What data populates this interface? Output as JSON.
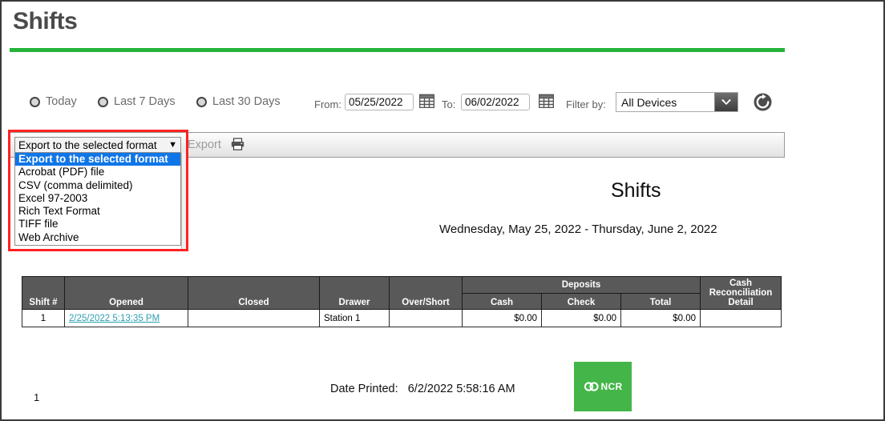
{
  "page": {
    "title": "Shifts",
    "accent_color": "#25b33a"
  },
  "filters": {
    "radios": [
      {
        "label": "Today",
        "selected": false
      },
      {
        "label": "Last 7 Days",
        "selected": false
      },
      {
        "label": "Last 30 Days",
        "selected": false
      }
    ],
    "from_label": "From:",
    "from_value": "05/25/2022",
    "to_label": "To:",
    "to_value": "06/02/2022",
    "filter_by_label": "Filter by:",
    "device_value": "All Devices",
    "refresh_icon": "refresh-icon",
    "calendar_icon": "calendar-icon"
  },
  "toolbar": {
    "export_label": "Export",
    "printer_icon": "printer-icon",
    "dropdown_selected": "Export to the selected format",
    "dropdown_options": [
      "Export to the selected format",
      "Acrobat (PDF) file",
      "CSV (comma delimited)",
      "Excel 97-2003",
      "Rich Text Format",
      "TIFF file",
      "Web Archive"
    ],
    "highlight_color": "#ff2222",
    "option_highlight_color": "#1076e8"
  },
  "report": {
    "title": "Shifts",
    "date_range": "Wednesday, May 25, 2022 - Thursday, June 2, 2022",
    "group_header": "Deposits",
    "columns": [
      "Shift #",
      "Opened",
      "Closed",
      "Drawer",
      "Over/Short",
      "Cash",
      "Check",
      "Total",
      "Cash Reconciliation Detail"
    ],
    "rows": [
      {
        "shift": "1",
        "opened": "2/25/2022 5:13:35 PM",
        "closed": "",
        "drawer": "Station 1",
        "over_short": "",
        "cash": "$0.00",
        "check": "$0.00",
        "total": "$0.00",
        "cash_recon": ""
      }
    ]
  },
  "footer": {
    "page_number": "1",
    "date_printed_label": "Date Printed:",
    "date_printed_value": "6/2/2022 5:58:16 AM",
    "logo_text": "NCR",
    "logo_color": "#44b649"
  }
}
